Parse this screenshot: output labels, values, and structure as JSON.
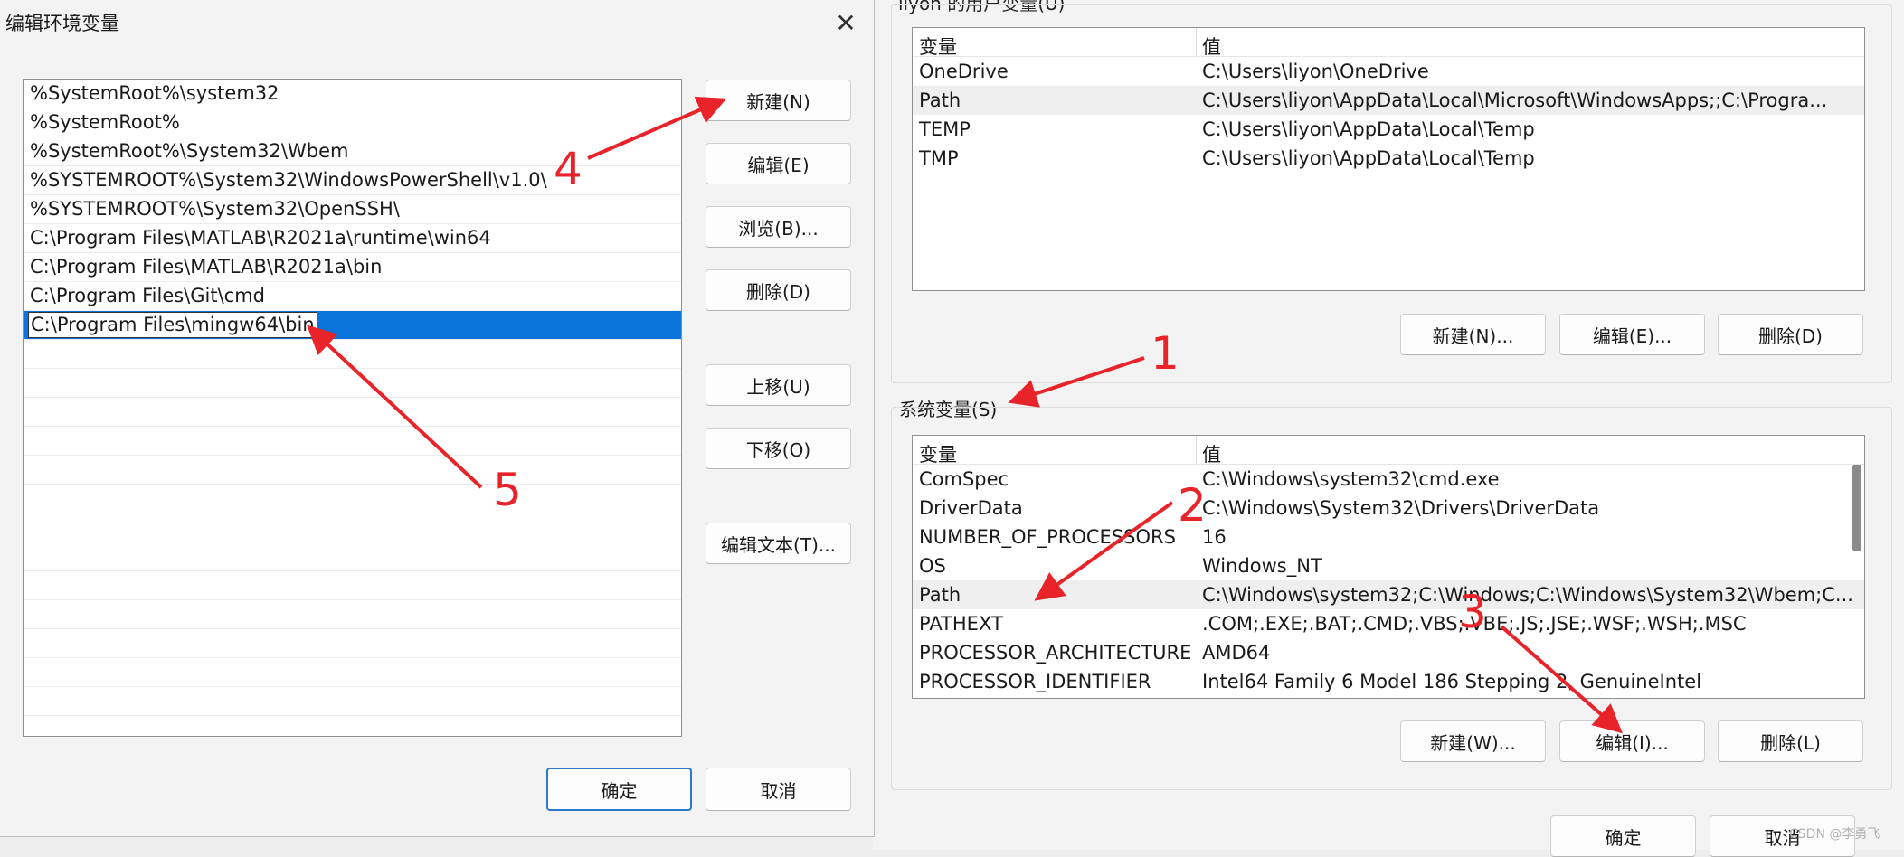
{
  "background_window": {
    "user_group_caption": "liyon 的用户变量(U)",
    "header_var": "变量",
    "header_val": "值",
    "user_vars": [
      {
        "name": "OneDrive",
        "value": "C:\\Users\\liyon\\OneDrive"
      },
      {
        "name": "Path",
        "value": "C:\\Users\\liyon\\AppData\\Local\\Microsoft\\WindowsApps;;C:\\Progra..."
      },
      {
        "name": "TEMP",
        "value": "C:\\Users\\liyon\\AppData\\Local\\Temp"
      },
      {
        "name": "TMP",
        "value": "C:\\Users\\liyon\\AppData\\Local\\Temp"
      }
    ],
    "user_buttons": {
      "new": "新建(N)...",
      "edit": "编辑(E)...",
      "delete": "删除(D)"
    },
    "system_caption": "系统变量(S)",
    "system_vars": [
      {
        "name": "ComSpec",
        "value": "C:\\Windows\\system32\\cmd.exe"
      },
      {
        "name": "DriverData",
        "value": "C:\\Windows\\System32\\Drivers\\DriverData"
      },
      {
        "name": "NUMBER_OF_PROCESSORS",
        "value": "16"
      },
      {
        "name": "OS",
        "value": "Windows_NT"
      },
      {
        "name": "Path",
        "value": "C:\\Windows\\system32;C:\\Windows;C:\\Windows\\System32\\Wbem;C..."
      },
      {
        "name": "PATHEXT",
        "value": ".COM;.EXE;.BAT;.CMD;.VBS;.VBE;.JS;.JSE;.WSF;.WSH;.MSC"
      },
      {
        "name": "PROCESSOR_ARCHITECTURE",
        "value": "AMD64"
      },
      {
        "name": "PROCESSOR_IDENTIFIER",
        "value": "Intel64 Family 6 Model 186 Stepping 2, GenuineIntel"
      }
    ],
    "system_buttons": {
      "new": "新建(W)...",
      "edit": "编辑(I)...",
      "delete": "删除(L)"
    },
    "ok": "确定",
    "cancel": "取消"
  },
  "dialog": {
    "title": "编辑环境变量",
    "close_glyph": "✕",
    "paths": [
      "%SystemRoot%\\system32",
      "%SystemRoot%",
      "%SystemRoot%\\System32\\Wbem",
      "%SYSTEMROOT%\\System32\\WindowsPowerShell\\v1.0\\",
      "%SYSTEMROOT%\\System32\\OpenSSH\\",
      "C:\\Program Files\\MATLAB\\R2021a\\runtime\\win64",
      "C:\\Program Files\\MATLAB\\R2021a\\bin",
      "C:\\Program Files\\Git\\cmd",
      "C:\\Program Files\\mingw64\\bin"
    ],
    "selected_index": 8,
    "buttons": {
      "new": "新建(N)",
      "edit": "编辑(E)",
      "browse": "浏览(B)...",
      "delete": "删除(D)",
      "move_up": "上移(U)",
      "move_down": "下移(O)",
      "edit_text": "编辑文本(T)..."
    },
    "ok": "确定",
    "cancel": "取消"
  },
  "annotations": {
    "colors": {
      "arrow": "#e8232a",
      "selection": "#0a74da"
    },
    "labels": {
      "a1": "1",
      "a2": "2",
      "a3": "3",
      "a4": "4",
      "a5": "5"
    }
  },
  "watermark": "CSDN @李勇飞"
}
